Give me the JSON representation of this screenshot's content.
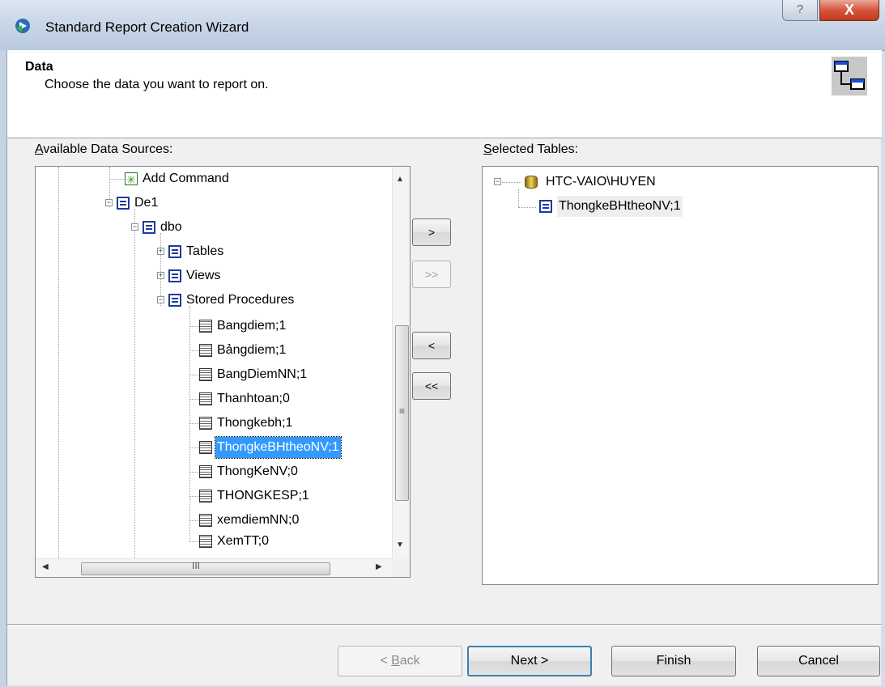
{
  "window": {
    "title": "Standard Report Creation Wizard",
    "help_glyph": "?",
    "close_glyph": "X"
  },
  "header": {
    "title": "Data",
    "subtitle": "Choose the data you want to report on."
  },
  "available": {
    "label_accel": "A",
    "label_rest": "vailable Data Sources:",
    "items": [
      {
        "label": "Add Command",
        "icon": "add-command-icon"
      },
      {
        "label": "De1",
        "icon": "table-icon",
        "expander": "−"
      },
      {
        "label": "dbo",
        "icon": "table-icon",
        "expander": "−"
      },
      {
        "label": "Tables",
        "icon": "table-icon",
        "expander": "+"
      },
      {
        "label": "Views",
        "icon": "table-icon",
        "expander": "+"
      },
      {
        "label": "Stored Procedures",
        "icon": "table-icon",
        "expander": "−"
      },
      {
        "label": "Bangdiem;1",
        "icon": "procedure-icon"
      },
      {
        "label": "Bảngdiem;1",
        "icon": "procedure-icon"
      },
      {
        "label": "BangDiemNN;1",
        "icon": "procedure-icon"
      },
      {
        "label": "Thanhtoan;0",
        "icon": "procedure-icon"
      },
      {
        "label": "Thongkebh;1",
        "icon": "procedure-icon"
      },
      {
        "label": "ThongkeBHtheoNV;1",
        "icon": "procedure-icon",
        "selected": true
      },
      {
        "label": "ThongKeNV;0",
        "icon": "procedure-icon"
      },
      {
        "label": "THONGKESP;1",
        "icon": "procedure-icon"
      },
      {
        "label": "xemdiemNN;0",
        "icon": "procedure-icon"
      },
      {
        "label": "XemTT;0",
        "icon": "procedure-icon"
      }
    ],
    "vscroll": {
      "up": "▲",
      "down": "▼",
      "grip": "≡"
    },
    "hscroll": {
      "left": "◀",
      "right": "▶",
      "grip": "III"
    }
  },
  "selected": {
    "label_accel": "S",
    "label_rest": "elected Tables:",
    "items": [
      {
        "label": "HTC-VAIO\\HUYEN",
        "icon": "database-icon",
        "expander": "−"
      },
      {
        "label": "ThongkeBHtheoNV;1",
        "icon": "table-icon"
      }
    ]
  },
  "move_buttons": {
    "add": ">",
    "add_all": ">>",
    "remove": "<",
    "remove_all": "<<"
  },
  "footer": {
    "back_pre": "< ",
    "back_accel": "B",
    "back_rest": "ack",
    "next": "Next >",
    "finish": "Finish",
    "cancel": "Cancel"
  }
}
